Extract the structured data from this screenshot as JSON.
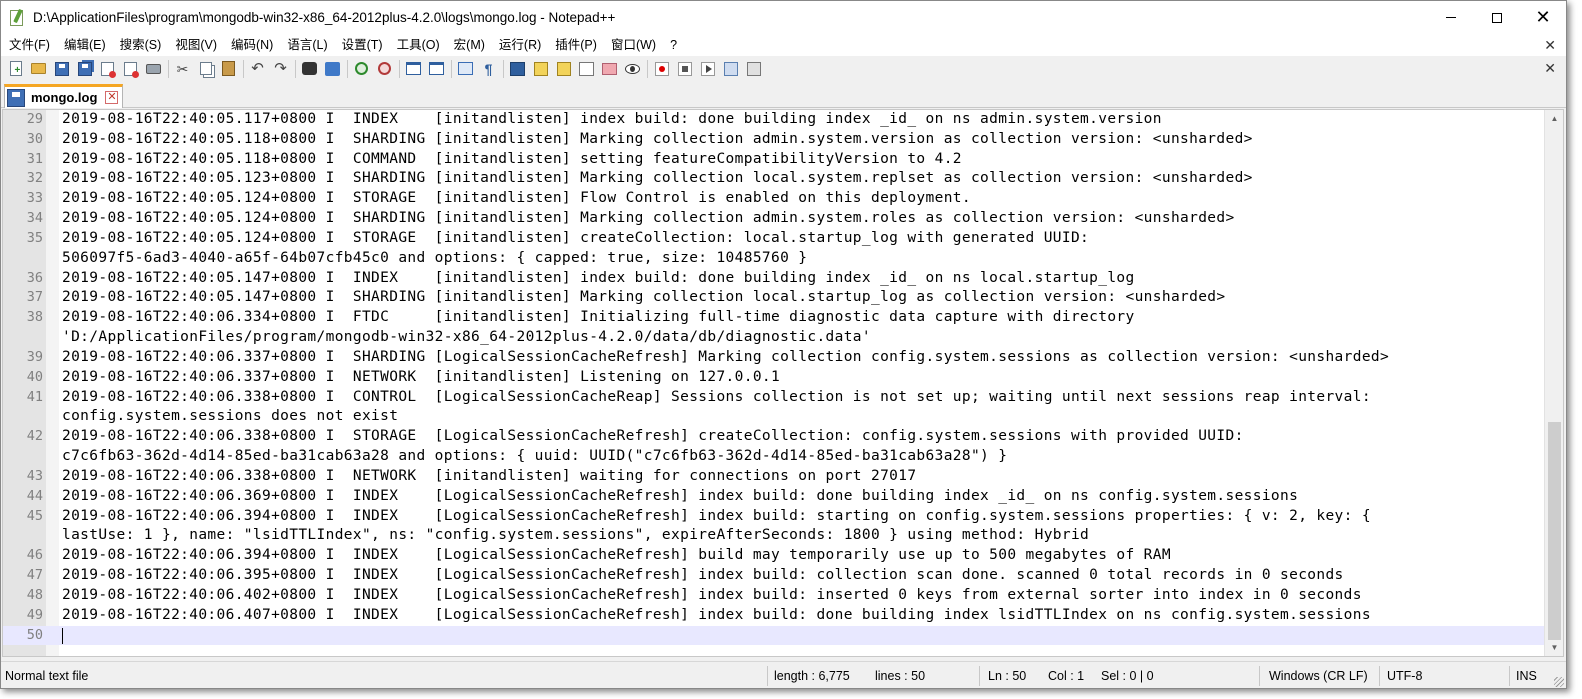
{
  "window": {
    "title": "D:\\ApplicationFiles\\program\\mongodb-win32-x86_64-2012plus-4.2.0\\logs\\mongo.log - Notepad++",
    "controls": {
      "minimize_icon": "minimize-icon",
      "maximize_icon": "maximize-icon",
      "close_glyph": "✕"
    }
  },
  "menu": {
    "items": [
      "文件(F)",
      "编辑(E)",
      "搜索(S)",
      "视图(V)",
      "编码(N)",
      "语言(L)",
      "设置(T)",
      "工具(O)",
      "宏(M)",
      "运行(R)",
      "插件(P)",
      "窗口(W)",
      "?"
    ],
    "close_glyph": "✕"
  },
  "toolbar": {
    "icons": [
      "new-file-icon",
      "open-file-icon",
      "save-icon",
      "save-all-icon",
      "close-icon",
      "close-all-icon",
      "print-icon",
      "cut-icon",
      "copy-icon",
      "paste-icon",
      "undo-icon",
      "redo-icon",
      "find-icon",
      "replace-icon",
      "zoom-in-icon",
      "zoom-out-icon",
      "sync-vertical-icon",
      "sync-horizontal-icon",
      "word-wrap-icon",
      "show-all-chars-icon",
      "indent-guide-icon",
      "user-defined-language-icon",
      "document-map-icon",
      "function-list-icon",
      "folder-as-workspace-icon",
      "monitoring-icon",
      "record-macro-icon",
      "stop-recording-icon",
      "playback-icon",
      "run-macro-multiple-icon",
      "save-macro-icon"
    ],
    "close_glyph": "✕",
    "redo_glyph": "↷",
    "undo_glyph": "↶",
    "cut_glyph": "✂",
    "para_glyph": "¶"
  },
  "tabs": [
    {
      "label": "mongo.log",
      "close_glyph": "✕",
      "active": true
    }
  ],
  "editor": {
    "lines": [
      {
        "num": "29",
        "text": "2019-08-16T22:40:05.117+0800 I  INDEX    [initandlisten] index build: done building index _id_ on ns admin.system.version"
      },
      {
        "num": "30",
        "text": "2019-08-16T22:40:05.118+0800 I  SHARDING [initandlisten] Marking collection admin.system.version as collection version: <unsharded>"
      },
      {
        "num": "31",
        "text": "2019-08-16T22:40:05.118+0800 I  COMMAND  [initandlisten] setting featureCompatibilityVersion to 4.2"
      },
      {
        "num": "32",
        "text": "2019-08-16T22:40:05.123+0800 I  SHARDING [initandlisten] Marking collection local.system.replset as collection version: <unsharded>"
      },
      {
        "num": "33",
        "text": "2019-08-16T22:40:05.124+0800 I  STORAGE  [initandlisten] Flow Control is enabled on this deployment."
      },
      {
        "num": "34",
        "text": "2019-08-16T22:40:05.124+0800 I  SHARDING [initandlisten] Marking collection admin.system.roles as collection version: <unsharded>"
      },
      {
        "num": "35",
        "text": "2019-08-16T22:40:05.124+0800 I  STORAGE  [initandlisten] createCollection: local.startup_log with generated UUID:"
      },
      {
        "num": "",
        "text": "506097f5-6ad3-4040-a65f-64b07cfb45c0 and options: { capped: true, size: 10485760 }"
      },
      {
        "num": "36",
        "text": "2019-08-16T22:40:05.147+0800 I  INDEX    [initandlisten] index build: done building index _id_ on ns local.startup_log"
      },
      {
        "num": "37",
        "text": "2019-08-16T22:40:05.147+0800 I  SHARDING [initandlisten] Marking collection local.startup_log as collection version: <unsharded>"
      },
      {
        "num": "38",
        "text": "2019-08-16T22:40:06.334+0800 I  FTDC     [initandlisten] Initializing full-time diagnostic data capture with directory"
      },
      {
        "num": "",
        "text": "'D:/ApplicationFiles/program/mongodb-win32-x86_64-2012plus-4.2.0/data/db/diagnostic.data'"
      },
      {
        "num": "39",
        "text": "2019-08-16T22:40:06.337+0800 I  SHARDING [LogicalSessionCacheRefresh] Marking collection config.system.sessions as collection version: <unsharded>"
      },
      {
        "num": "40",
        "text": "2019-08-16T22:40:06.337+0800 I  NETWORK  [initandlisten] Listening on 127.0.0.1"
      },
      {
        "num": "41",
        "text": "2019-08-16T22:40:06.338+0800 I  CONTROL  [LogicalSessionCacheReap] Sessions collection is not set up; waiting until next sessions reap interval:"
      },
      {
        "num": "",
        "text": "config.system.sessions does not exist"
      },
      {
        "num": "42",
        "text": "2019-08-16T22:40:06.338+0800 I  STORAGE  [LogicalSessionCacheRefresh] createCollection: config.system.sessions with provided UUID:"
      },
      {
        "num": "",
        "text": "c7c6fb63-362d-4d14-85ed-ba31cab63a28 and options: { uuid: UUID(\"c7c6fb63-362d-4d14-85ed-ba31cab63a28\") }"
      },
      {
        "num": "43",
        "text": "2019-08-16T22:40:06.338+0800 I  NETWORK  [initandlisten] waiting for connections on port 27017"
      },
      {
        "num": "44",
        "text": "2019-08-16T22:40:06.369+0800 I  INDEX    [LogicalSessionCacheRefresh] index build: done building index _id_ on ns config.system.sessions"
      },
      {
        "num": "45",
        "text": "2019-08-16T22:40:06.394+0800 I  INDEX    [LogicalSessionCacheRefresh] index build: starting on config.system.sessions properties: { v: 2, key: {"
      },
      {
        "num": "",
        "text": "lastUse: 1 }, name: \"lsidTTLIndex\", ns: \"config.system.sessions\", expireAfterSeconds: 1800 } using method: Hybrid"
      },
      {
        "num": "46",
        "text": "2019-08-16T22:40:06.394+0800 I  INDEX    [LogicalSessionCacheRefresh] build may temporarily use up to 500 megabytes of RAM"
      },
      {
        "num": "47",
        "text": "2019-08-16T22:40:06.395+0800 I  INDEX    [LogicalSessionCacheRefresh] index build: collection scan done. scanned 0 total records in 0 seconds"
      },
      {
        "num": "48",
        "text": "2019-08-16T22:40:06.402+0800 I  INDEX    [LogicalSessionCacheRefresh] index build: inserted 0 keys from external sorter into index in 0 seconds"
      },
      {
        "num": "49",
        "text": "2019-08-16T22:40:06.407+0800 I  INDEX    [LogicalSessionCacheRefresh] index build: done building index lsidTTLIndex on ns config.system.sessions"
      },
      {
        "num": "50",
        "text": ""
      }
    ],
    "current_line_number": "50",
    "scroll_up_glyph": "▲",
    "scroll_down_glyph": "▼"
  },
  "status": {
    "file_type": "Normal text file",
    "length": "length : 6,775",
    "lines": "lines : 50",
    "ln": "Ln : 50",
    "col": "Col : 1",
    "sel": "Sel : 0 | 0",
    "eol": "Windows (CR LF)",
    "encoding": "UTF-8",
    "mode": "INS"
  },
  "colors": {
    "tab_accent": "#f5a623",
    "current_line": "#e8e8ff",
    "gutter": "#e4e4e4",
    "line_number": "#808080"
  }
}
